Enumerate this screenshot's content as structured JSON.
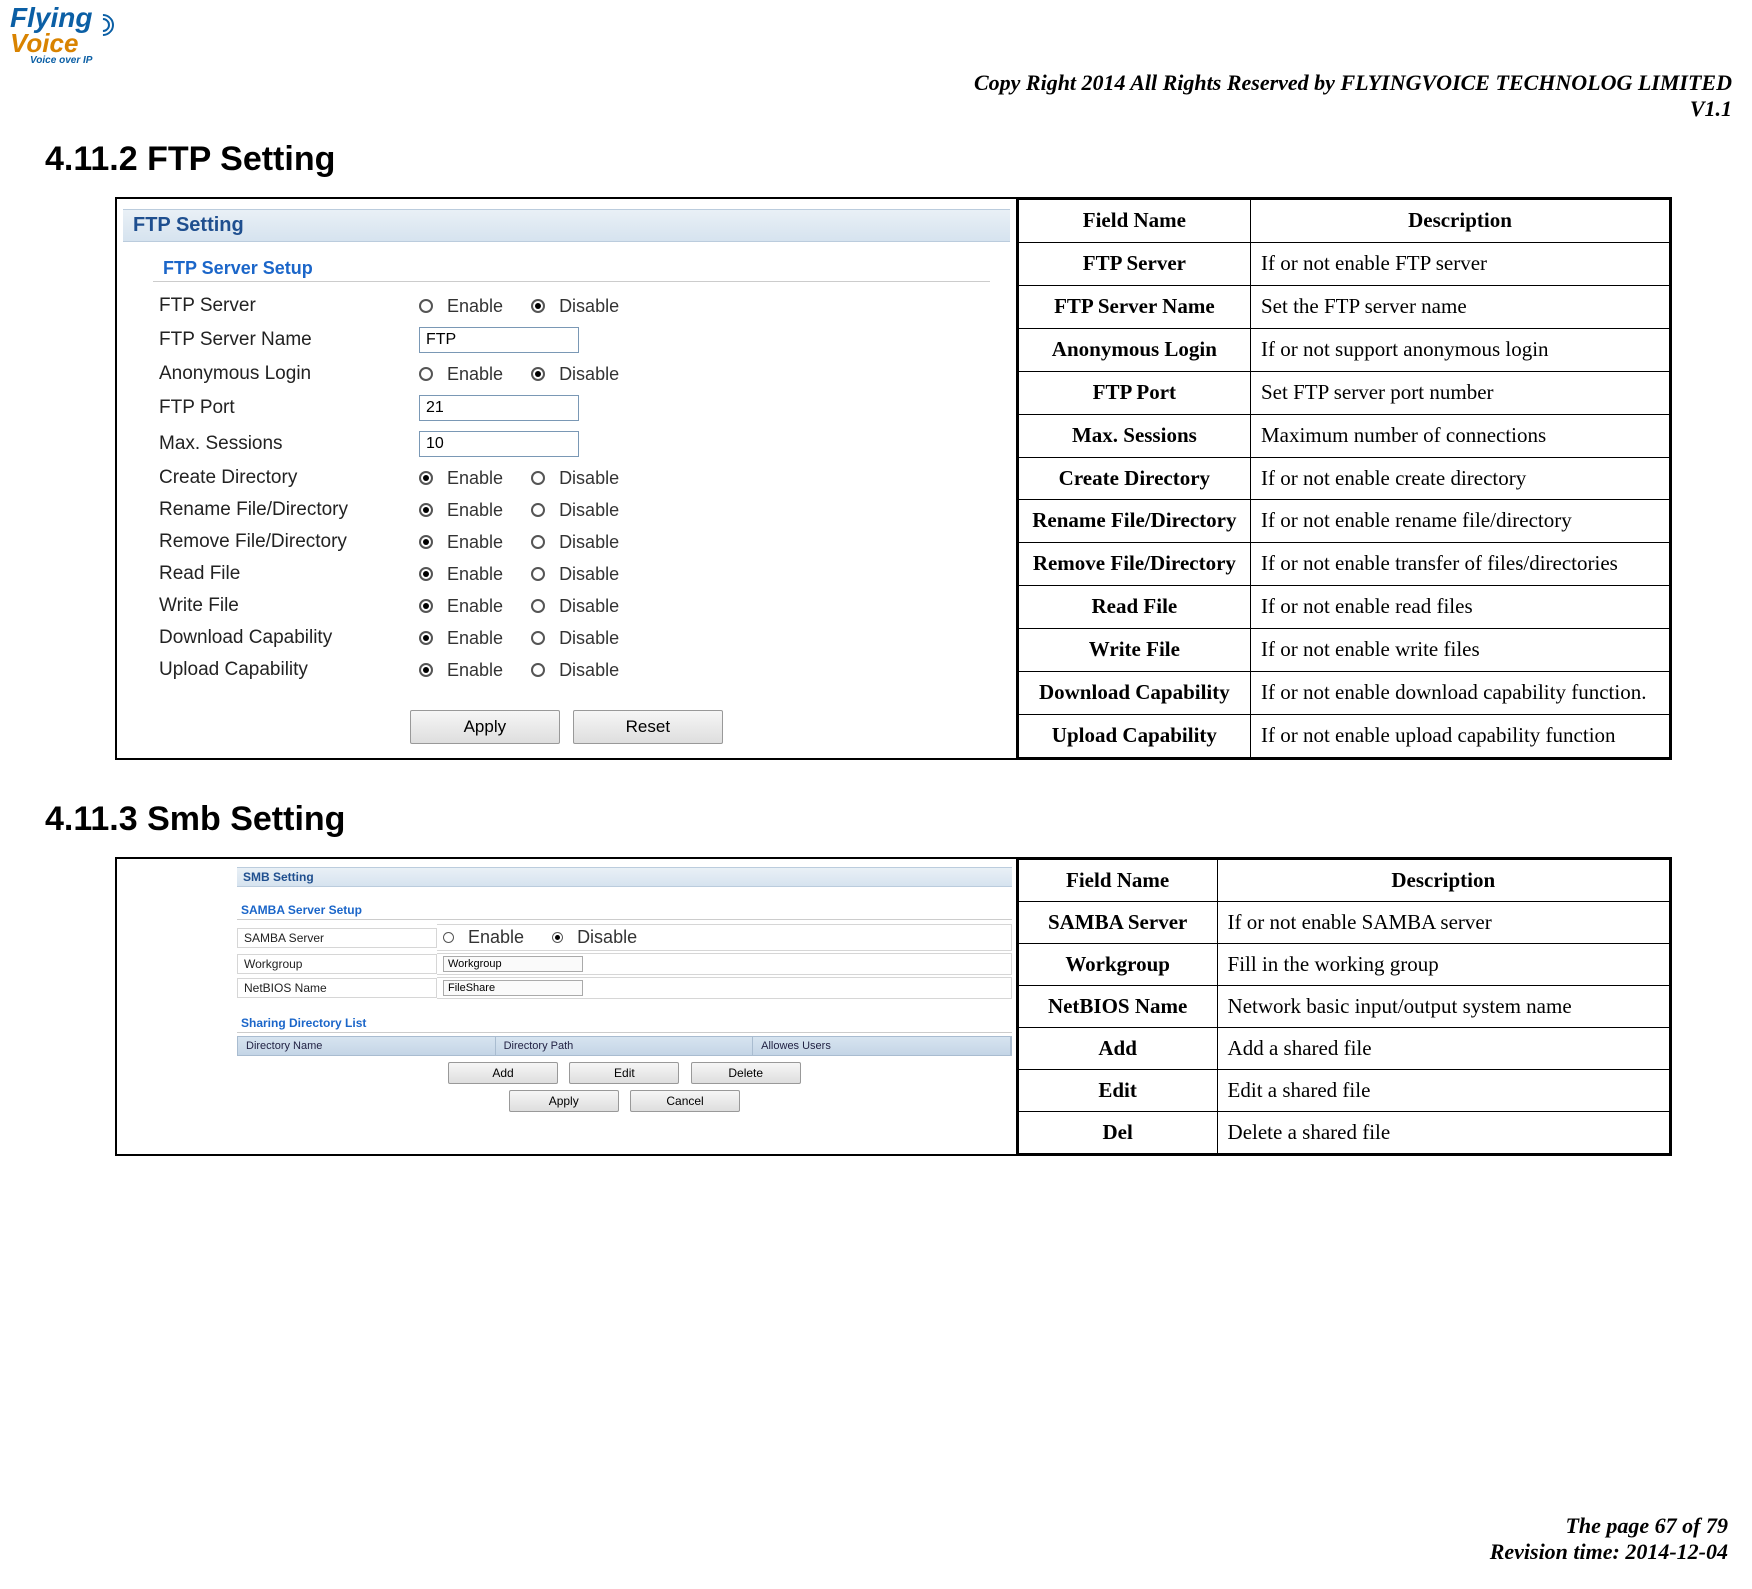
{
  "header": {
    "logo_top": "Flying",
    "logo_bottom": "Voice",
    "logo_tag": "Voice over IP",
    "copyright": "Copy Right 2014 All Rights Reserved by FLYINGVOICE TECHNOLOG LIMITED",
    "version": "V1.1"
  },
  "ftp": {
    "heading": "4.11.2  FTP Setting",
    "panel_title": "FTP Setting",
    "group_title": "FTP Server Setup",
    "rows": {
      "ftp_server": "FTP Server",
      "ftp_server_name": "FTP Server Name",
      "anon_login": "Anonymous Login",
      "ftp_port": "FTP Port",
      "max_sessions": "Max. Sessions",
      "create_dir": "Create Directory",
      "rename": "Rename File/Directory",
      "remove": "Remove File/Directory",
      "read_file": "Read File",
      "write_file": "Write File",
      "download_cap": "Download Capability",
      "upload_cap": "Upload Capability"
    },
    "values": {
      "server_name": "FTP",
      "port": "21",
      "max_sessions": "10"
    },
    "labels": {
      "enable": "Enable",
      "disable": "Disable",
      "apply": "Apply",
      "reset": "Reset"
    },
    "desc": [
      {
        "field": "Field Name",
        "text": "Description",
        "is_header": true
      },
      {
        "field": "FTP Server",
        "text": "If or not enable FTP server"
      },
      {
        "field": "FTP Server Name",
        "text": "Set the FTP server name"
      },
      {
        "field": "Anonymous Login",
        "text": "If or not support anonymous login"
      },
      {
        "field": "FTP Port",
        "text": "Set FTP server port number"
      },
      {
        "field": "Max. Sessions",
        "text": "Maximum number of connections"
      },
      {
        "field": "Create Directory",
        "text": "If or not enable create directory"
      },
      {
        "field": "Rename File/Directory",
        "text": "If or not enable rename file/directory"
      },
      {
        "field": "Remove File/Directory",
        "text": "If or not enable transfer of files/directories"
      },
      {
        "field": "Read File",
        "text": "If or not enable read files"
      },
      {
        "field": "Write File",
        "text": "If or not enable write files"
      },
      {
        "field": "Download Capability",
        "text": "If or not enable download capability function."
      },
      {
        "field": "Upload Capability",
        "text": "If or not enable upload capability function"
      }
    ]
  },
  "smb": {
    "heading": "4.11.3  Smb Setting",
    "panel_title": "SMB Setting",
    "group_title": "SAMBA Server Setup",
    "rows": {
      "samba_server": "SAMBA Server",
      "workgroup": "Workgroup",
      "netbios": "NetBIOS Name"
    },
    "values": {
      "workgroup": "Workgroup",
      "netbios": "FileShare"
    },
    "share_title": "Sharing Directory List",
    "share_cols": {
      "name": "Directory Name",
      "path": "Directory Path",
      "users": "Allowes Users"
    },
    "labels": {
      "enable": "Enable",
      "disable": "Disable",
      "add": "Add",
      "edit": "Edit",
      "delete": "Delete",
      "apply": "Apply",
      "cancel": "Cancel"
    },
    "desc": [
      {
        "field": "Field Name",
        "text": "Description",
        "is_header": true
      },
      {
        "field": "SAMBA Server",
        "text": "If or not enable SAMBA server"
      },
      {
        "field": "Workgroup",
        "text": "Fill in the working group"
      },
      {
        "field": "NetBIOS Name",
        "text": "Network basic input/output system name"
      },
      {
        "field": "Add",
        "text": "Add a shared file"
      },
      {
        "field": "Edit",
        "text": "Edit a shared file"
      },
      {
        "field": "Del",
        "text": "Delete a shared file"
      }
    ]
  },
  "footer": {
    "page": "The page 67 of 79",
    "revision": "Revision time: 2014-12-04"
  }
}
